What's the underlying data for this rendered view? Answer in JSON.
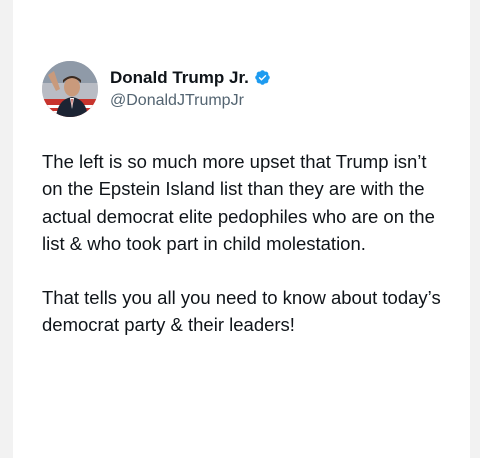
{
  "tweet": {
    "author": {
      "display_name": "Donald Trump Jr.",
      "handle": "@DonaldJTrumpJr",
      "verified_icon": "verified-badge-icon",
      "verified_color": "#1d9bf0"
    },
    "paragraphs": [
      "The left is so much more upset that Trump isn’t on the Epstein Island list than they are with the actual democrat elite pedophiles who are on the list & who took part in child molestation.",
      "That tells you all you need to know about today’s democrat party & their leaders!"
    ]
  },
  "colors": {
    "page_background": "#f2f2f2",
    "card_background": "#ffffff",
    "text_primary": "#0f1419",
    "text_secondary": "#536471"
  }
}
